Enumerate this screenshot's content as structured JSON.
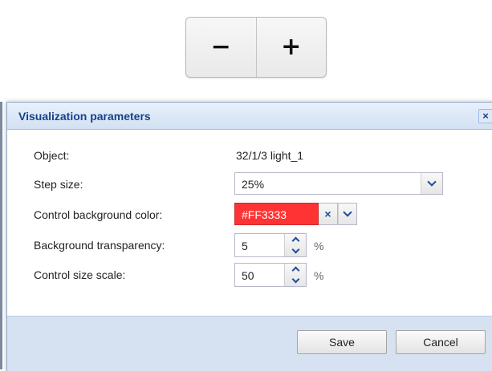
{
  "control_preview": {
    "minus_label": "−",
    "plus_label": "+"
  },
  "dialog": {
    "title": "Visualization parameters",
    "close_label": "×",
    "fields": {
      "object": {
        "label": "Object:",
        "value": "32/1/3 light_1"
      },
      "step_size": {
        "label": "Step size:",
        "value": "25%"
      },
      "bg_color": {
        "label": "Control background color:",
        "value": "#FF3333",
        "clear_label": "×"
      },
      "bg_transparency": {
        "label": "Background transparency:",
        "value": "5",
        "unit": "%"
      },
      "size_scale": {
        "label": "Control size scale:",
        "value": "50",
        "unit": "%"
      }
    },
    "buttons": {
      "save": "Save",
      "cancel": "Cancel"
    }
  },
  "colors": {
    "control_background": "#FF3333",
    "dialog_title": "#15428b",
    "footer_background": "#d6e2f1"
  },
  "icons": {
    "close": "close-icon",
    "dropdown": "chevron-down-icon",
    "clear": "clear-icon",
    "spin_up": "chevron-up-icon",
    "spin_down": "chevron-down-icon"
  }
}
